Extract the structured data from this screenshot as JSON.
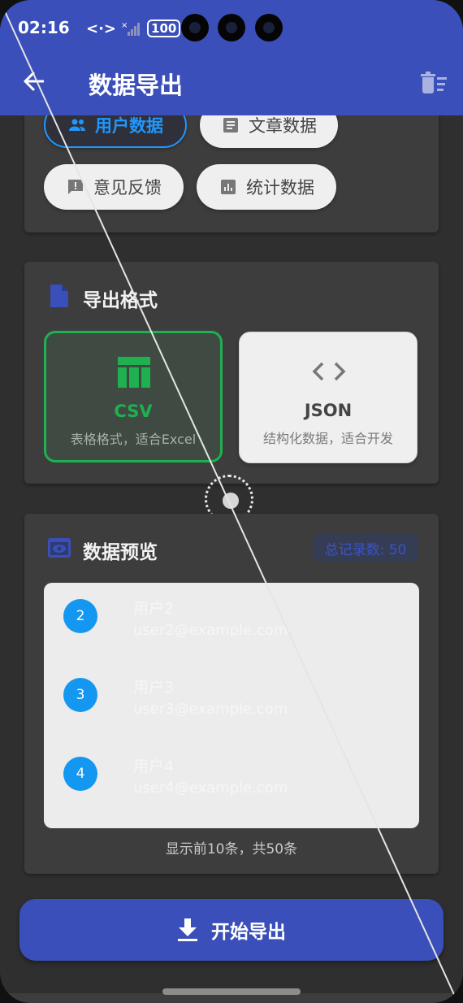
{
  "status_bar": {
    "time": "02:16",
    "network_code": "<·>",
    "signal_label": "×",
    "battery": "100"
  },
  "header": {
    "title": "数据导出",
    "back_icon": "arrow-left-icon",
    "delete_icon": "delete-sweep-icon"
  },
  "data_types": {
    "chips": [
      {
        "label": "用户数据",
        "icon": "people-icon",
        "selected": true
      },
      {
        "label": "文章数据",
        "icon": "article-icon",
        "selected": false
      },
      {
        "label": "意见反馈",
        "icon": "feedback-icon",
        "selected": false
      },
      {
        "label": "统计数据",
        "icon": "bar-chart-icon",
        "selected": false
      }
    ]
  },
  "export_format": {
    "title": "导出格式",
    "options": [
      {
        "name": "CSV",
        "desc": "表格格式，适合Excel",
        "icon": "table-icon",
        "selected": true
      },
      {
        "name": "JSON",
        "desc": "结构化数据，适合开发",
        "icon": "code-icon",
        "selected": false
      }
    ]
  },
  "preview": {
    "title": "数据预览",
    "record_count": "总记录数: 50",
    "rows": [
      {
        "index": "2",
        "name": "用户2",
        "email": "user2@example.com"
      },
      {
        "index": "3",
        "name": "用户3",
        "email": "user3@example.com"
      },
      {
        "index": "4",
        "name": "用户4",
        "email": "user4@example.com"
      }
    ],
    "footer": "显示前10条，共50条"
  },
  "actions": {
    "export_label": "开始导出",
    "export_icon": "download-icon"
  },
  "colors": {
    "primary": "#3a4fb9",
    "selected_chip": "#1f97ff",
    "csv_green": "#1fb050",
    "number_badge": "#1497f0"
  }
}
